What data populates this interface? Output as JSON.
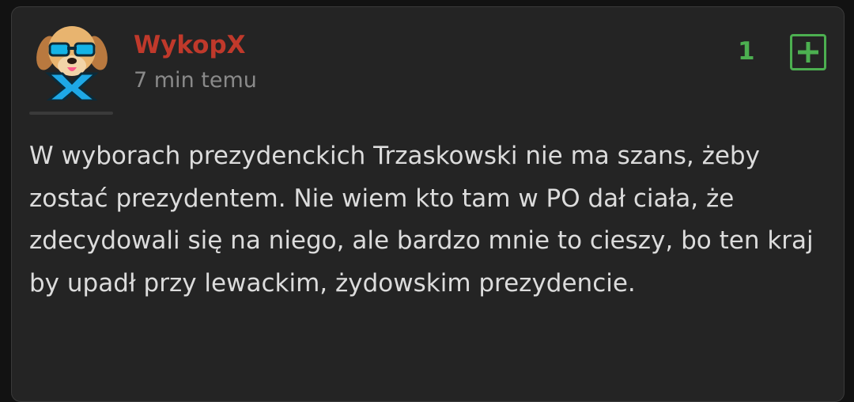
{
  "comment": {
    "author": "WykopX",
    "time_ago": "7 min temu",
    "votes": "1",
    "text": "W wyborach prezydenckich Trzaskowski nie ma szans, żeby zostać prezydentem. Nie wiem kto tam w PO dał ciała, że zdecydowali się na niego, ale bardzo mnie to cieszy, bo ten kraj by upadł przy lewackim, żydowskim prezydencie."
  },
  "icons": {
    "avatar": "dog-with-sunglasses-and-x-avatar",
    "upvote": "plus-square-icon"
  },
  "colors": {
    "author": "#c0392b",
    "votes": "#4caf50",
    "text": "#dcdcdc",
    "muted": "#8a8a8a",
    "card": "#242424"
  }
}
